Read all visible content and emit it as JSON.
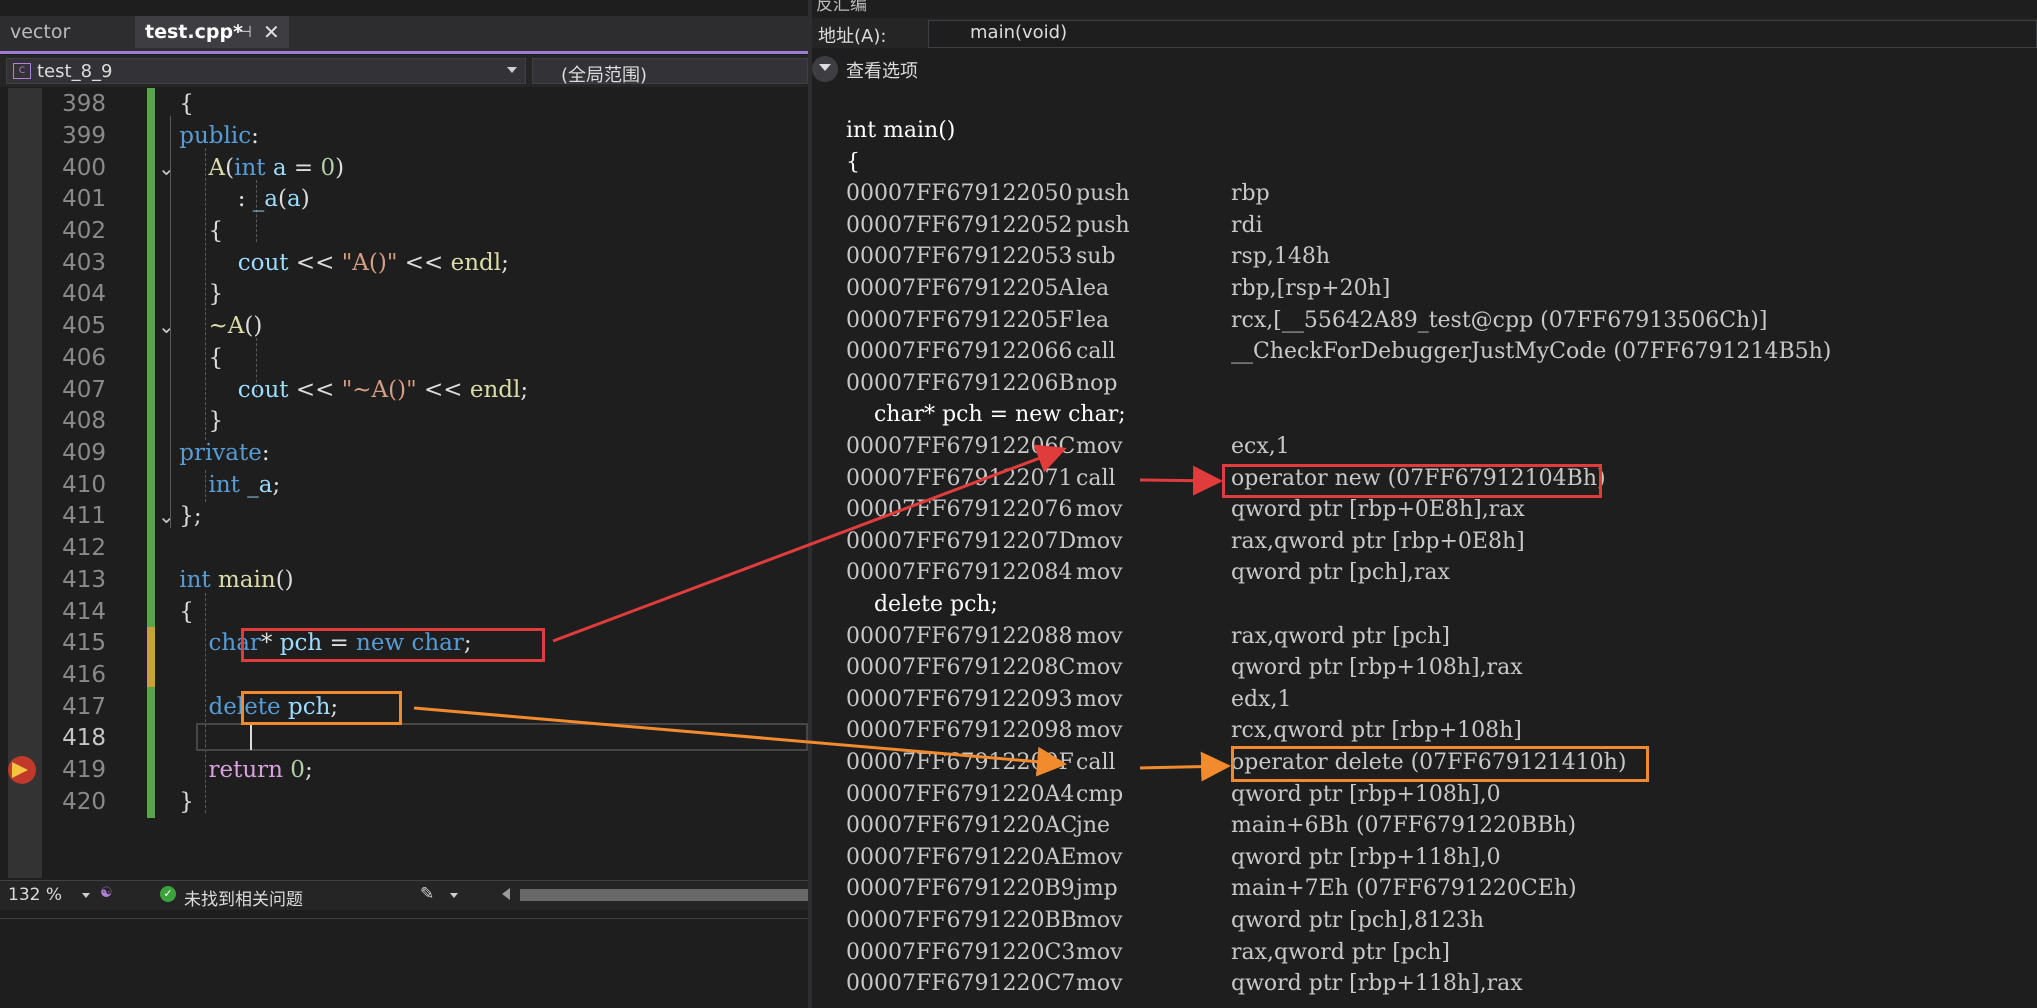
{
  "left": {
    "tabs": [
      {
        "label": "vector"
      },
      {
        "label": "test.cpp*",
        "pin": "⊣",
        "close": "✕"
      }
    ],
    "nav": {
      "scope": "test_8_9",
      "scope_icon": "C",
      "global_scope": "(全局范围)"
    },
    "lines": [
      {
        "num": "398",
        "text": "    {"
      },
      {
        "num": "399",
        "text": "    public:"
      },
      {
        "num": "400",
        "text": "        A(int a = 0)"
      },
      {
        "num": "401",
        "text": "            : _a(a)"
      },
      {
        "num": "402",
        "text": "        {"
      },
      {
        "num": "403",
        "text": "            cout << \"A()\" << endl;"
      },
      {
        "num": "404",
        "text": "        }"
      },
      {
        "num": "405",
        "text": "        ~A()"
      },
      {
        "num": "406",
        "text": "        {"
      },
      {
        "num": "407",
        "text": "            cout << \"~A()\" << endl;"
      },
      {
        "num": "408",
        "text": "        }"
      },
      {
        "num": "409",
        "text": "    private:"
      },
      {
        "num": "410",
        "text": "        int _a;"
      },
      {
        "num": "411",
        "text": "    };"
      },
      {
        "num": "412",
        "text": ""
      },
      {
        "num": "413",
        "text": "    int main()"
      },
      {
        "num": "414",
        "text": "    {"
      },
      {
        "num": "415",
        "text": "        char* pch = new char;"
      },
      {
        "num": "416",
        "text": ""
      },
      {
        "num": "417",
        "text": "        delete pch;"
      },
      {
        "num": "418",
        "text": ""
      },
      {
        "num": "419",
        "text": "        return 0;"
      },
      {
        "num": "420",
        "text": "    }"
      }
    ],
    "status": {
      "zoom": "132 %",
      "issues": "未找到相关问题"
    }
  },
  "right": {
    "title": "反汇编",
    "address_label": "地址(A):",
    "address_value": "main(void)",
    "view_options": "查看选项",
    "lines": [
      {
        "src": "int main()"
      },
      {
        "src": "{"
      },
      {
        "addr": "00007FF679122050",
        "mn": "push",
        "op": "rbp"
      },
      {
        "addr": "00007FF679122052",
        "mn": "push",
        "op": "rdi"
      },
      {
        "addr": "00007FF679122053",
        "mn": "sub",
        "op": "rsp,148h"
      },
      {
        "addr": "00007FF67912205A",
        "mn": "lea",
        "op": "rbp,[rsp+20h]"
      },
      {
        "addr": "00007FF67912205F",
        "mn": "lea",
        "op": "rcx,[__55642A89_test@cpp (07FF67913506Ch)]"
      },
      {
        "addr": "00007FF679122066",
        "mn": "call",
        "op": "__CheckForDebuggerJustMyCode (07FF6791214B5h)"
      },
      {
        "addr": "00007FF67912206B",
        "mn": "nop",
        "op": ""
      },
      {
        "src": "    char* pch = new char;"
      },
      {
        "addr": "00007FF67912206C",
        "mn": "mov",
        "op": "ecx,1"
      },
      {
        "addr": "00007FF679122071",
        "mn": "call",
        "op": "operator new (07FF67912104Bh)"
      },
      {
        "addr": "00007FF679122076",
        "mn": "mov",
        "op": "qword ptr [rbp+0E8h],rax"
      },
      {
        "addr": "00007FF67912207D",
        "mn": "mov",
        "op": "rax,qword ptr [rbp+0E8h]"
      },
      {
        "addr": "00007FF679122084",
        "mn": "mov",
        "op": "qword ptr [pch],rax"
      },
      {
        "src": "    delete pch;"
      },
      {
        "addr": "00007FF679122088",
        "mn": "mov",
        "op": "rax,qword ptr [pch]"
      },
      {
        "addr": "00007FF67912208C",
        "mn": "mov",
        "op": "qword ptr [rbp+108h],rax"
      },
      {
        "addr": "00007FF679122093",
        "mn": "mov",
        "op": "edx,1"
      },
      {
        "addr": "00007FF679122098",
        "mn": "mov",
        "op": "rcx,qword ptr [rbp+108h]"
      },
      {
        "addr": "00007FF67912209F",
        "mn": "call",
        "op": "operator delete (07FF679121410h)"
      },
      {
        "addr": "00007FF6791220A4",
        "mn": "cmp",
        "op": "qword ptr [rbp+108h],0"
      },
      {
        "addr": "00007FF6791220AC",
        "mn": "jne",
        "op": "main+6Bh (07FF6791220BBh)"
      },
      {
        "addr": "00007FF6791220AE",
        "mn": "mov",
        "op": "qword ptr [rbp+118h],0"
      },
      {
        "addr": "00007FF6791220B9",
        "mn": "jmp",
        "op": "main+7Eh (07FF6791220CEh)"
      },
      {
        "addr": "00007FF6791220BB",
        "mn": "mov",
        "op": "qword ptr [pch],8123h"
      },
      {
        "addr": "00007FF6791220C3",
        "mn": "mov",
        "op": "rax,qword ptr [pch]"
      },
      {
        "addr": "00007FF6791220C7",
        "mn": "mov",
        "op": "qword ptr [rbp+118h],rax"
      }
    ]
  },
  "colors": {
    "annotation_red": "#e03c3c",
    "annotation_orange": "#f28a2e",
    "change_bar": "#57a64a"
  },
  "icons": [
    "pin-icon",
    "close-icon",
    "class-icon",
    "dropdown-caret-icon",
    "health-icon",
    "check-circle-icon",
    "brush-icon",
    "breakpoint-arrow-icon",
    "chevron-down-icon"
  ]
}
